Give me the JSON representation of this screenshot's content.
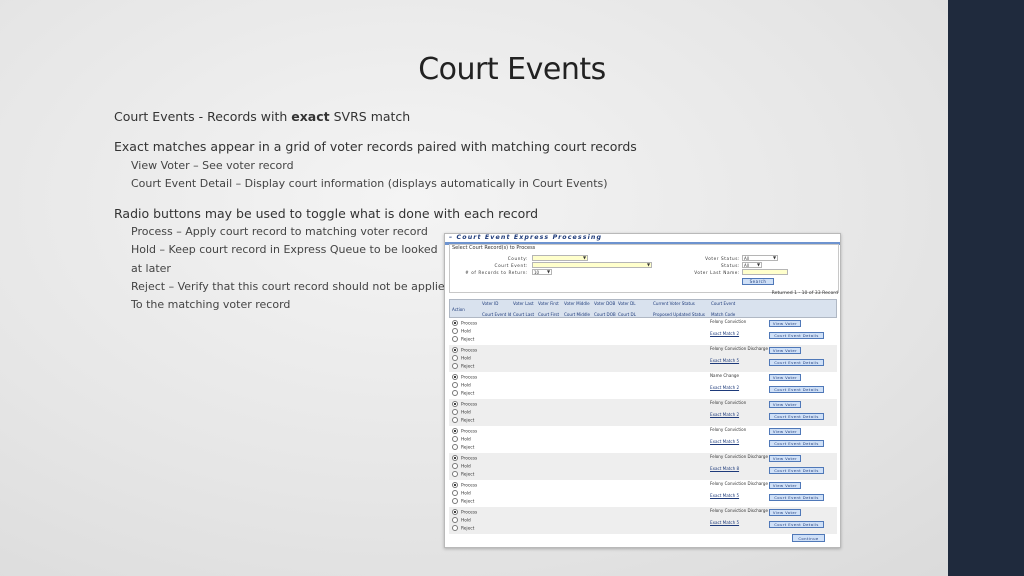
{
  "slide": {
    "title": "Court Events",
    "subtitle_pre": "Court Events - Records with ",
    "subtitle_bold": "exact",
    "subtitle_post": " SVRS match",
    "section1": {
      "heading": "Exact matches appear in a grid of voter records paired with matching court records",
      "items": [
        "View Voter – See voter record",
        "Court Event Detail – Display court information (displays automatically in Court Events)"
      ]
    },
    "section2": {
      "heading": "Radio buttons may be used to toggle what is done with each record",
      "items": [
        "Process – Apply court record to matching voter record",
        "Hold – Keep court record in Express Queue to be looked",
        "at later",
        "Reject – Verify that this court record should not be applied",
        "To the matching voter record"
      ]
    }
  },
  "screenshot": {
    "title": "– Court Event Express Processing",
    "filter_legend": "Select Court Record(s) to Process",
    "filters": {
      "county_label": "County:",
      "court_event_label": "Court Event:",
      "records_label": "# of Records to Return:",
      "records_value": "10",
      "voter_status_label": "Voter Status:",
      "voter_status_value": "All",
      "status_label": "Status:",
      "status_value": "All",
      "voter_last_name_label": "Voter Last Name:",
      "search_button": "Search"
    },
    "returned": "Returned 1 - 10 of 33 Record",
    "headers_top": [
      "Action",
      "Voter ID",
      "Voter Last",
      "Voter First",
      "Voter Middle",
      "Voter DOB",
      "Voter DL",
      "Current Voter Status",
      "Court Event"
    ],
    "headers_bottom": [
      "Court Event Id",
      "Court Last",
      "Court First",
      "Court Middle",
      "Court DOB",
      "Court DL",
      "Proposed Updated Status",
      "Match Code"
    ],
    "radio_labels": [
      "Process",
      "Hold",
      "Reject"
    ],
    "rows": [
      {
        "event": "Felony Conviction",
        "match": "Exact Match 2"
      },
      {
        "event": "Felony Conviction Discharge",
        "match": "Exact Match 5"
      },
      {
        "event": "Name Change",
        "match": "Exact Match 2"
      },
      {
        "event": "Felony Conviction",
        "match": "Exact Match 2"
      },
      {
        "event": "Felony Conviction",
        "match": "Exact Match 5"
      },
      {
        "event": "Felony Conviction Discharge",
        "match": "Exact Match 8"
      },
      {
        "event": "Felony Conviction Discharge",
        "match": "Exact Match 5"
      },
      {
        "event": "Felony Conviction Discharge",
        "match": "Exact Match 5"
      }
    ],
    "view_voter_button": "View Voter",
    "court_event_details_button": "Court Event Details",
    "continue_button": "Continue"
  }
}
